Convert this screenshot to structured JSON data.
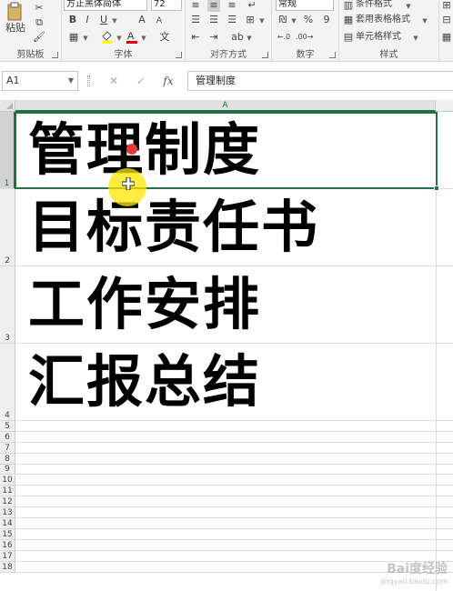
{
  "ribbon": {
    "clipboard": {
      "paste_label": "粘贴",
      "group_label": "剪贴板"
    },
    "font": {
      "font_name": "方正黑体简体",
      "font_size": "72",
      "group_label": "字体",
      "bold": "B",
      "italic": "I",
      "underline": "U",
      "grow": "A",
      "shrink": "A",
      "phonetic": "文"
    },
    "alignment": {
      "group_label": "对齐方式"
    },
    "number": {
      "format": "常规",
      "percent": "%",
      "comma": "9",
      "group_label": "数字"
    },
    "styles": {
      "conditional": "条件格式",
      "table_format": "套用表格格式",
      "cell_styles": "单元格样式",
      "group_label": "样式"
    }
  },
  "formula_bar": {
    "name_box": "A1",
    "cancel": "✕",
    "enter": "✓",
    "fx": "fx",
    "content": "管理制度"
  },
  "sheet": {
    "column_header": "A",
    "row_numbers": [
      "1",
      "2",
      "3",
      "4",
      "5",
      "6",
      "7",
      "8",
      "9",
      "10",
      "11",
      "12",
      "13",
      "14",
      "15",
      "16",
      "17",
      "18"
    ],
    "cells": [
      "管理制度",
      "目标责任书",
      "工作安排",
      "汇报总结"
    ]
  },
  "watermark": {
    "main": "Bai度经验",
    "sub": "jingyan.baidu.com"
  },
  "colors": {
    "accent": "#217346",
    "highlight": "#ffe600",
    "pointer": "#e53935"
  }
}
